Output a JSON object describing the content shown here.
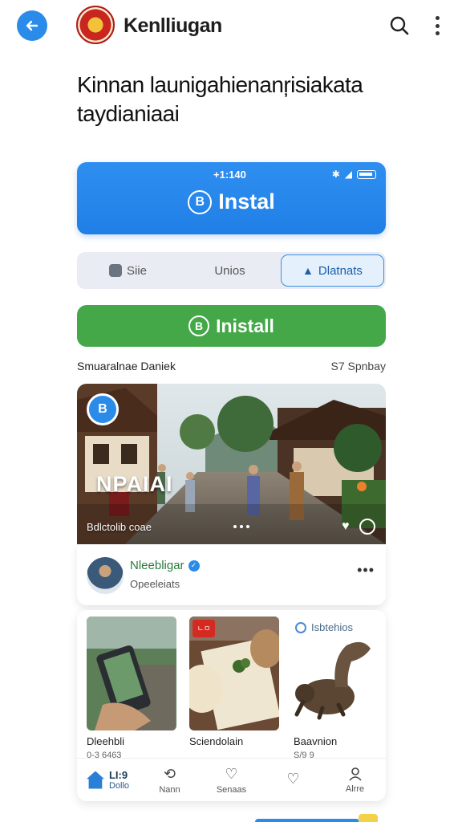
{
  "header": {
    "title": "Kenlliugan",
    "back_icon": "arrow-left-icon",
    "search_icon": "search-icon",
    "more_icon": "more-vertical-icon"
  },
  "headline": "Kinnan launigahienanŗisiakata taydianiaai",
  "hero": {
    "status_time": "+1:140",
    "label": "Instal",
    "glyph": "B"
  },
  "segments": [
    {
      "label": "Siie"
    },
    {
      "label": "Unios"
    },
    {
      "label": "Dlatnats"
    }
  ],
  "install": {
    "label": "Inistall",
    "glyph": "B"
  },
  "section": {
    "left": "Smuaralnae Daniek",
    "right": "S7 Spnbay"
  },
  "feature": {
    "badge": "B",
    "title": "NPAIAI",
    "caption": "Bdlctolib coae"
  },
  "author": {
    "name": "Nleebligar",
    "sub": "Opeeleiats",
    "more": "•••"
  },
  "tiles": [
    {
      "label": "Dleehbli",
      "sub": "0-3    6463",
      "tag": ""
    },
    {
      "label": "Sciendolain",
      "sub": "",
      "tag": "ㄴㅁ"
    },
    {
      "label": "Baavnion",
      "sub": "S/9  9",
      "head": "Isbtehios"
    }
  ],
  "bottom_nav": [
    {
      "label": "Dollo",
      "value": "LI:9",
      "icon": "home-icon"
    },
    {
      "label": "Nann",
      "icon": "repeat-icon"
    },
    {
      "label": "Senaas",
      "icon": "heart-outline-icon"
    },
    {
      "label": "",
      "icon": "heart-icon"
    },
    {
      "label": "Alrre",
      "icon": "user-icon"
    }
  ],
  "colors": {
    "primary_blue": "#2a8be8",
    "install_green": "#44a849",
    "author_green": "#2b7a3c"
  }
}
